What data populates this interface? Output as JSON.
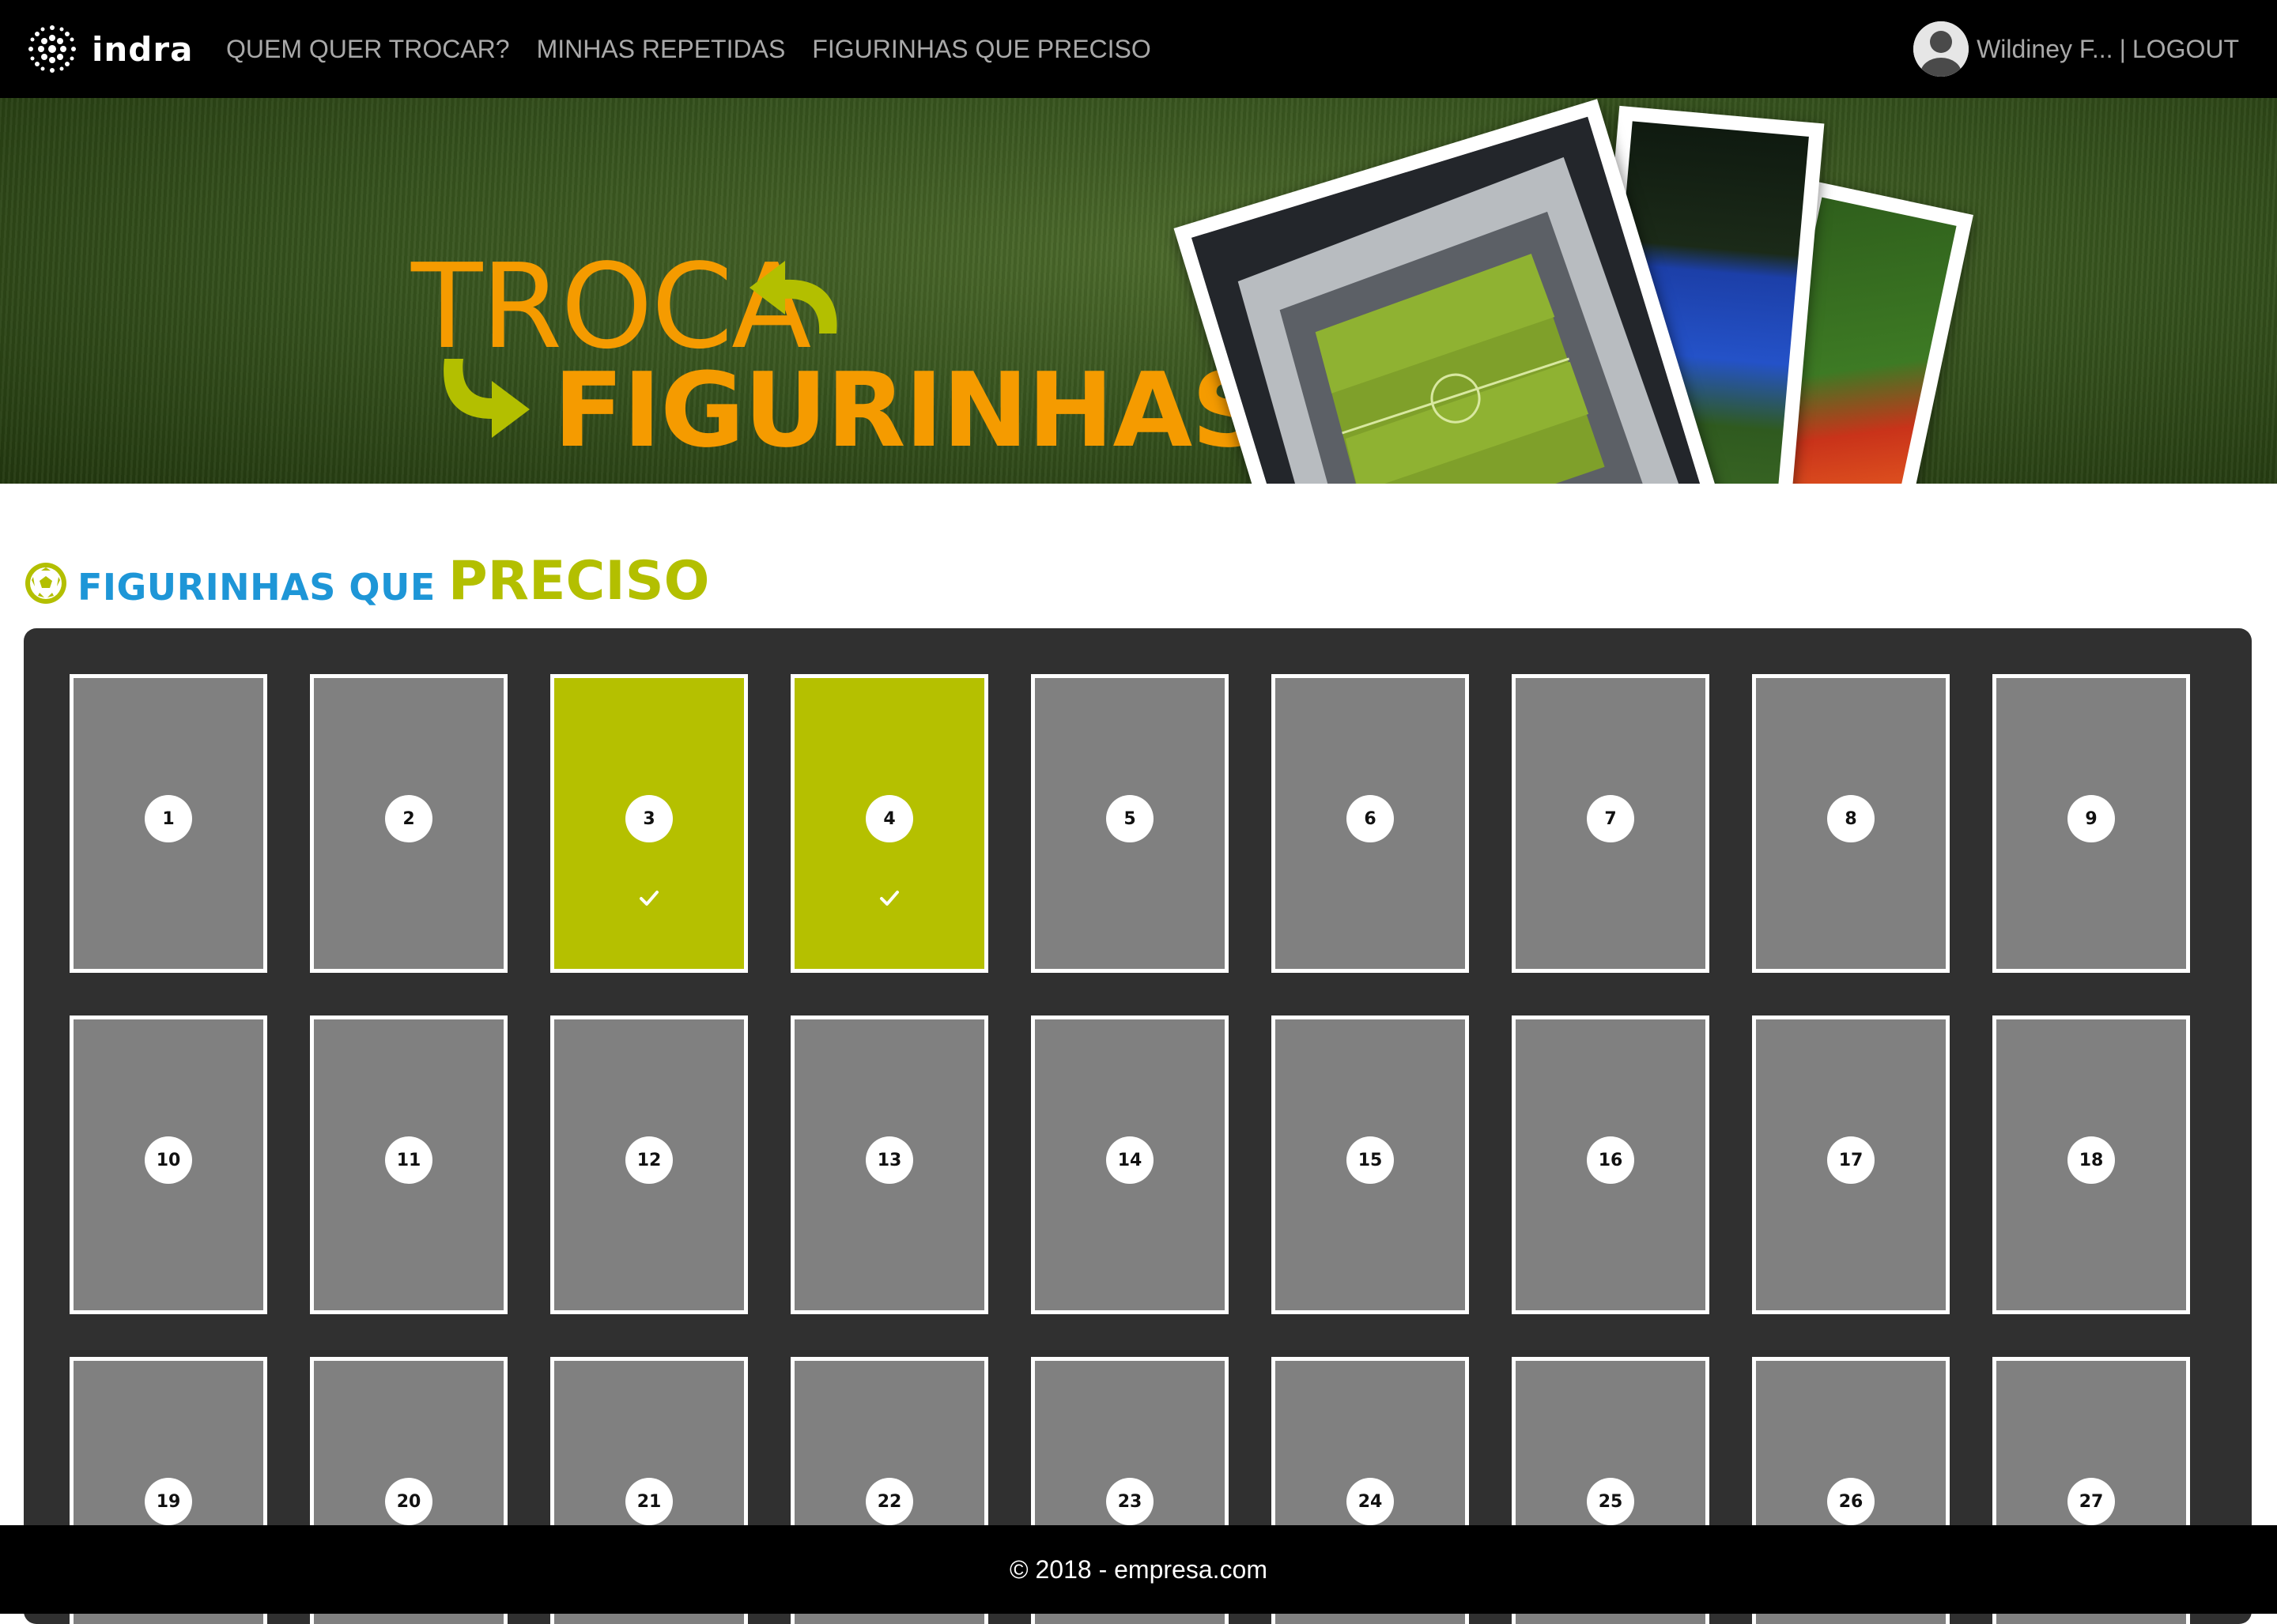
{
  "navbar": {
    "brand": "indra",
    "links": [
      {
        "label": "QUEM QUER TROCAR?"
      },
      {
        "label": "MINHAS REPETIDAS"
      },
      {
        "label": "FIGURINHAS QUE PRECISO"
      }
    ],
    "user_name": "Wildiney F...",
    "separator": "|",
    "logout_label": "LOGOUT"
  },
  "banner": {
    "line1": "TROCA",
    "line2": "FIGURINHAS",
    "accent_color": "#f59b00",
    "arrow_color": "#b3bf00"
  },
  "section": {
    "title_part1": "FIGURINHAS QUE",
    "title_part2": "PRECISO",
    "icon": "soccer-ball-icon"
  },
  "stickers": {
    "owned_color": "#b5c000",
    "missing_color": "#808080",
    "items": [
      {
        "number": "1",
        "owned": false
      },
      {
        "number": "2",
        "owned": false
      },
      {
        "number": "3",
        "owned": true
      },
      {
        "number": "4",
        "owned": true
      },
      {
        "number": "5",
        "owned": false
      },
      {
        "number": "6",
        "owned": false
      },
      {
        "number": "7",
        "owned": false
      },
      {
        "number": "8",
        "owned": false
      },
      {
        "number": "9",
        "owned": false
      },
      {
        "number": "10",
        "owned": false
      },
      {
        "number": "11",
        "owned": false
      },
      {
        "number": "12",
        "owned": false
      },
      {
        "number": "13",
        "owned": false
      },
      {
        "number": "14",
        "owned": false
      },
      {
        "number": "15",
        "owned": false
      },
      {
        "number": "16",
        "owned": false
      },
      {
        "number": "17",
        "owned": false
      },
      {
        "number": "18",
        "owned": false
      },
      {
        "number": "19",
        "owned": false
      },
      {
        "number": "20",
        "owned": false
      },
      {
        "number": "21",
        "owned": false
      },
      {
        "number": "22",
        "owned": false
      },
      {
        "number": "23",
        "owned": false
      },
      {
        "number": "24",
        "owned": false
      },
      {
        "number": "25",
        "owned": false
      },
      {
        "number": "26",
        "owned": false
      },
      {
        "number": "27",
        "owned": false
      }
    ]
  },
  "footer": {
    "text": "© 2018 - empresa.com"
  }
}
